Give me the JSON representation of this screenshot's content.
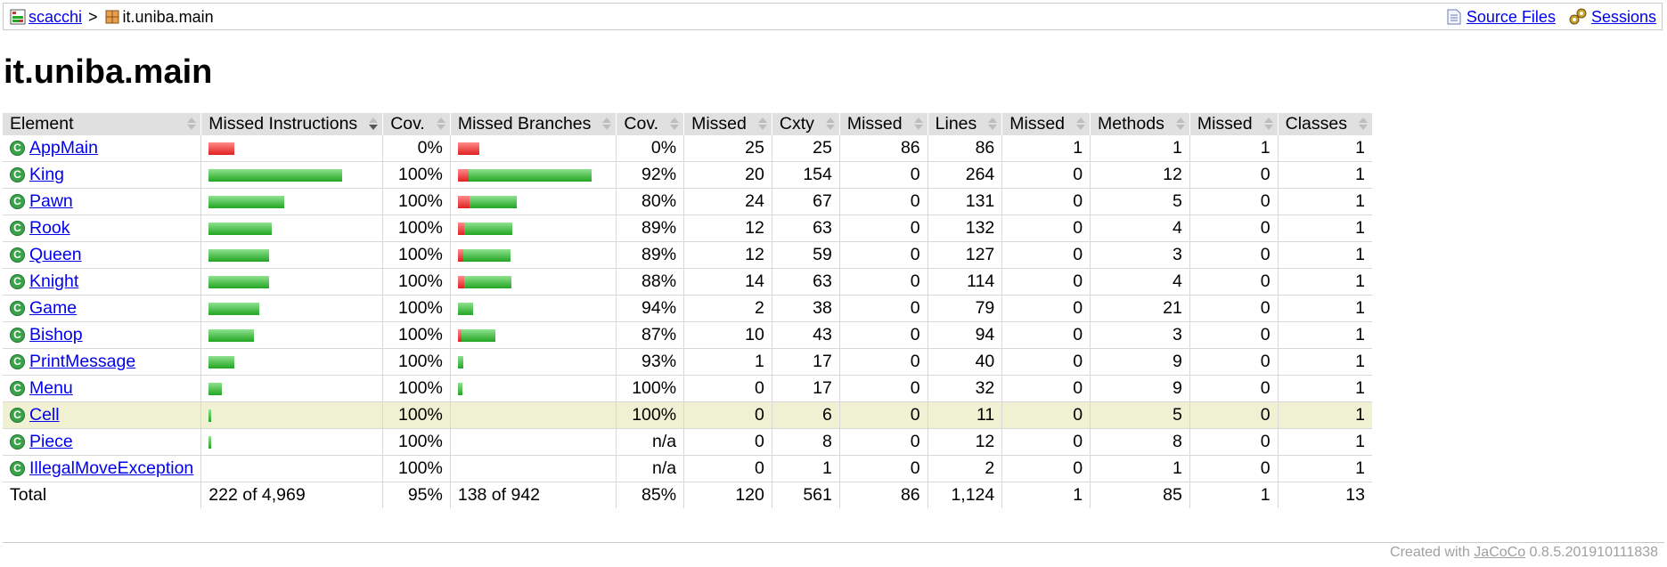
{
  "breadcrumb": {
    "root": "scacchi",
    "separator": ">",
    "current": "it.uniba.main",
    "links": {
      "source_files": "Source Files",
      "sessions": "Sessions"
    }
  },
  "page_title": "it.uniba.main",
  "table": {
    "headers": {
      "element": "Element",
      "missed_instructions": "Missed Instructions",
      "cov_instructions": "Cov.",
      "missed_branches": "Missed Branches",
      "cov_branches": "Cov.",
      "missed_cxty": "Missed",
      "cxty": "Cxty",
      "missed_lines": "Missed",
      "lines": "Lines",
      "missed_methods": "Missed",
      "methods": "Methods",
      "missed_classes": "Missed",
      "classes": "Classes"
    },
    "rows": [
      {
        "name": "AppMain",
        "instr_missed_frac": 1.0,
        "instr_total_rel": 0.19,
        "instr_cov": "0%",
        "br_missed_frac": 1.0,
        "br_total_rel": 0.16,
        "br_cov": "0%",
        "missed_cxty": "25",
        "cxty": "25",
        "missed_lines": "86",
        "lines": "86",
        "missed_methods": "1",
        "methods": "1",
        "missed_classes": "1",
        "classes": "1"
      },
      {
        "name": "King",
        "instr_missed_frac": 0.0,
        "instr_total_rel": 1.0,
        "instr_cov": "100%",
        "br_missed_frac": 0.08,
        "br_total_rel": 1.0,
        "br_cov": "92%",
        "missed_cxty": "20",
        "cxty": "154",
        "missed_lines": "0",
        "lines": "264",
        "missed_methods": "0",
        "methods": "12",
        "missed_classes": "0",
        "classes": "1"
      },
      {
        "name": "Pawn",
        "instr_missed_frac": 0.0,
        "instr_total_rel": 0.57,
        "instr_cov": "100%",
        "br_missed_frac": 0.2,
        "br_total_rel": 0.44,
        "br_cov": "80%",
        "missed_cxty": "24",
        "cxty": "67",
        "missed_lines": "0",
        "lines": "131",
        "missed_methods": "0",
        "methods": "5",
        "missed_classes": "0",
        "classes": "1"
      },
      {
        "name": "Rook",
        "instr_missed_frac": 0.0,
        "instr_total_rel": 0.47,
        "instr_cov": "100%",
        "br_missed_frac": 0.11,
        "br_total_rel": 0.41,
        "br_cov": "89%",
        "missed_cxty": "12",
        "cxty": "63",
        "missed_lines": "0",
        "lines": "132",
        "missed_methods": "0",
        "methods": "4",
        "missed_classes": "0",
        "classes": "1"
      },
      {
        "name": "Queen",
        "instr_missed_frac": 0.0,
        "instr_total_rel": 0.45,
        "instr_cov": "100%",
        "br_missed_frac": 0.11,
        "br_total_rel": 0.39,
        "br_cov": "89%",
        "missed_cxty": "12",
        "cxty": "59",
        "missed_lines": "0",
        "lines": "127",
        "missed_methods": "0",
        "methods": "3",
        "missed_classes": "0",
        "classes": "1"
      },
      {
        "name": "Knight",
        "instr_missed_frac": 0.0,
        "instr_total_rel": 0.45,
        "instr_cov": "100%",
        "br_missed_frac": 0.12,
        "br_total_rel": 0.4,
        "br_cov": "88%",
        "missed_cxty": "14",
        "cxty": "63",
        "missed_lines": "0",
        "lines": "114",
        "missed_methods": "0",
        "methods": "4",
        "missed_classes": "0",
        "classes": "1"
      },
      {
        "name": "Game",
        "instr_missed_frac": 0.0,
        "instr_total_rel": 0.38,
        "instr_cov": "100%",
        "br_missed_frac": 0.0,
        "br_total_rel": 0.11,
        "br_cov": "94%",
        "missed_cxty": "2",
        "cxty": "38",
        "missed_lines": "0",
        "lines": "79",
        "missed_methods": "0",
        "methods": "21",
        "missed_classes": "0",
        "classes": "1"
      },
      {
        "name": "Bishop",
        "instr_missed_frac": 0.0,
        "instr_total_rel": 0.34,
        "instr_cov": "100%",
        "br_missed_frac": 0.1,
        "br_total_rel": 0.28,
        "br_cov": "87%",
        "missed_cxty": "10",
        "cxty": "43",
        "missed_lines": "0",
        "lines": "94",
        "missed_methods": "0",
        "methods": "3",
        "missed_classes": "0",
        "classes": "1"
      },
      {
        "name": "PrintMessage",
        "instr_missed_frac": 0.0,
        "instr_total_rel": 0.19,
        "instr_cov": "100%",
        "br_missed_frac": 0.0,
        "br_total_rel": 0.04,
        "br_cov": "93%",
        "missed_cxty": "1",
        "cxty": "17",
        "missed_lines": "0",
        "lines": "40",
        "missed_methods": "0",
        "methods": "9",
        "missed_classes": "0",
        "classes": "1"
      },
      {
        "name": "Menu",
        "instr_missed_frac": 0.0,
        "instr_total_rel": 0.1,
        "instr_cov": "100%",
        "br_missed_frac": 0.0,
        "br_total_rel": 0.03,
        "br_cov": "100%",
        "missed_cxty": "0",
        "cxty": "17",
        "missed_lines": "0",
        "lines": "32",
        "missed_methods": "0",
        "methods": "9",
        "missed_classes": "0",
        "classes": "1"
      },
      {
        "name": "Cell",
        "instr_missed_frac": 0.0,
        "instr_total_rel": 0.02,
        "instr_cov": "100%",
        "br_missed_frac": 0.0,
        "br_total_rel": 0.0,
        "br_cov": "100%",
        "missed_cxty": "0",
        "cxty": "6",
        "missed_lines": "0",
        "lines": "11",
        "missed_methods": "0",
        "methods": "5",
        "missed_classes": "0",
        "classes": "1",
        "highlight": true
      },
      {
        "name": "Piece",
        "instr_missed_frac": 0.0,
        "instr_total_rel": 0.02,
        "instr_cov": "100%",
        "br_missed_frac": 0.0,
        "br_total_rel": 0.0,
        "br_cov": "n/a",
        "missed_cxty": "0",
        "cxty": "8",
        "missed_lines": "0",
        "lines": "12",
        "missed_methods": "0",
        "methods": "8",
        "missed_classes": "0",
        "classes": "1"
      },
      {
        "name": "IllegalMoveException",
        "instr_missed_frac": 0.0,
        "instr_total_rel": 0.0,
        "instr_cov": "100%",
        "br_missed_frac": 0.0,
        "br_total_rel": 0.0,
        "br_cov": "n/a",
        "missed_cxty": "0",
        "cxty": "1",
        "missed_lines": "0",
        "lines": "2",
        "missed_methods": "0",
        "methods": "1",
        "missed_classes": "0",
        "classes": "1"
      }
    ],
    "total": {
      "label": "Total",
      "instr": "222 of 4,969",
      "instr_cov": "95%",
      "br": "138 of 942",
      "br_cov": "85%",
      "missed_cxty": "120",
      "cxty": "561",
      "missed_lines": "86",
      "lines": "1,124",
      "missed_methods": "1",
      "methods": "85",
      "missed_classes": "1",
      "classes": "13"
    }
  },
  "footer": {
    "prefix": "Created with ",
    "link": "JaCoCo",
    "version": " 0.8.5.201910111838"
  },
  "colors": {
    "header_bg": "#e0e0e0",
    "highlight_row": "#f0f0d2",
    "bar_red": "#e02020",
    "bar_green": "#22a522",
    "link": "#0000ee"
  },
  "icons": {
    "report": "report-icon",
    "package": "package-icon",
    "source": "source-files-icon",
    "sessions": "sessions-icon",
    "class": "class-icon",
    "sort": "sort-arrows-icon"
  }
}
